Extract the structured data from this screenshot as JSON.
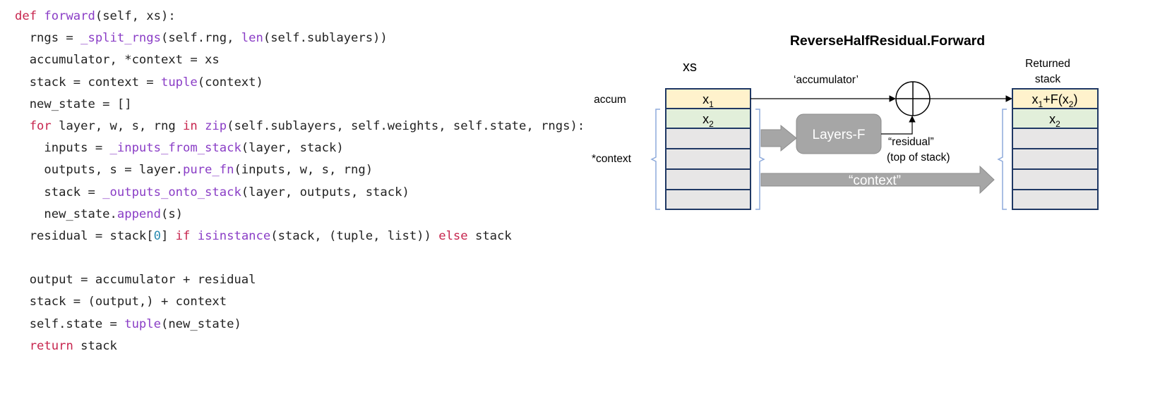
{
  "code": {
    "lines": [
      [
        {
          "t": "def ",
          "c": "kw"
        },
        {
          "t": "forward",
          "c": "fn"
        },
        {
          "t": "(self, xs):"
        }
      ],
      [
        {
          "t": "  rngs = "
        },
        {
          "t": "_split_rngs",
          "c": "fn"
        },
        {
          "t": "(self.rng, "
        },
        {
          "t": "len",
          "c": "fn"
        },
        {
          "t": "(self.sublayers))"
        }
      ],
      [
        {
          "t": "  accumulator, *context = xs"
        }
      ],
      [
        {
          "t": "  stack = context = "
        },
        {
          "t": "tuple",
          "c": "fn"
        },
        {
          "t": "(context)"
        }
      ],
      [
        {
          "t": "  new_state = []"
        }
      ],
      [
        {
          "t": "  "
        },
        {
          "t": "for",
          "c": "kw"
        },
        {
          "t": " layer, w, s, rng "
        },
        {
          "t": "in",
          "c": "kw"
        },
        {
          "t": " "
        },
        {
          "t": "zip",
          "c": "fn"
        },
        {
          "t": "(self.sublayers, self.weights, self.state, rngs):"
        }
      ],
      [
        {
          "t": "    inputs = "
        },
        {
          "t": "_inputs_from_stack",
          "c": "fn"
        },
        {
          "t": "(layer, stack)"
        }
      ],
      [
        {
          "t": "    outputs, s = layer."
        },
        {
          "t": "pure_fn",
          "c": "fn"
        },
        {
          "t": "(inputs, w, s, rng)"
        }
      ],
      [
        {
          "t": "    stack = "
        },
        {
          "t": "_outputs_onto_stack",
          "c": "fn"
        },
        {
          "t": "(layer, outputs, stack)"
        }
      ],
      [
        {
          "t": "    new_state."
        },
        {
          "t": "append",
          "c": "fn"
        },
        {
          "t": "(s)"
        }
      ],
      [
        {
          "t": "  residual = stack["
        },
        {
          "t": "0",
          "c": "num"
        },
        {
          "t": "] "
        },
        {
          "t": "if",
          "c": "kw"
        },
        {
          "t": " "
        },
        {
          "t": "isinstance",
          "c": "fn"
        },
        {
          "t": "(stack, (tuple, list)) "
        },
        {
          "t": "else",
          "c": "kw"
        },
        {
          "t": " stack"
        }
      ],
      [
        {
          "t": ""
        }
      ],
      [
        {
          "t": "  output = accumulator + residual"
        }
      ],
      [
        {
          "t": "  stack = (output,) + context"
        }
      ],
      [
        {
          "t": "  self.state = "
        },
        {
          "t": "tuple",
          "c": "fn"
        },
        {
          "t": "(new_state)"
        }
      ],
      [
        {
          "t": "  "
        },
        {
          "t": "return",
          "c": "kw"
        },
        {
          "t": " stack"
        }
      ]
    ]
  },
  "diagram": {
    "title": "ReverseHalfResidual.Forward",
    "input_label": "xs",
    "accum_label": "accum",
    "context_label": "*context",
    "input_cells": {
      "x1_base": "x",
      "x1_sub": "1",
      "x2_base": "x",
      "x2_sub": "2"
    },
    "accumulator_label": "‘accumulator’",
    "layers_label": "Layers-F",
    "residual_label": "“residual”",
    "residual_sublabel": "(top of stack)",
    "context_arrow_label": "“context”",
    "returned_label_line1": "Returned",
    "returned_label_line2": "stack",
    "output_cells": {
      "top_a": "x",
      "top_a_sub": "1",
      "top_b": "+F(x",
      "top_b_sub": "2",
      "top_c": ")",
      "x2_base": "x",
      "x2_sub": "2"
    },
    "colors": {
      "cell_border": "#1f3864",
      "accum_fill": "#fff2cc",
      "x2_fill": "#e2efda",
      "empty_fill": "#e7e6e6",
      "brace": "#8eaadb",
      "arrow_gray": "#a6a6a6",
      "arrow_gray_stroke": "#8c8c8c",
      "layers_fill": "#a6a6a6",
      "code_keyword": "#c7254e",
      "code_function": "#8a3dc6",
      "code_number": "#2a8bb0"
    }
  }
}
